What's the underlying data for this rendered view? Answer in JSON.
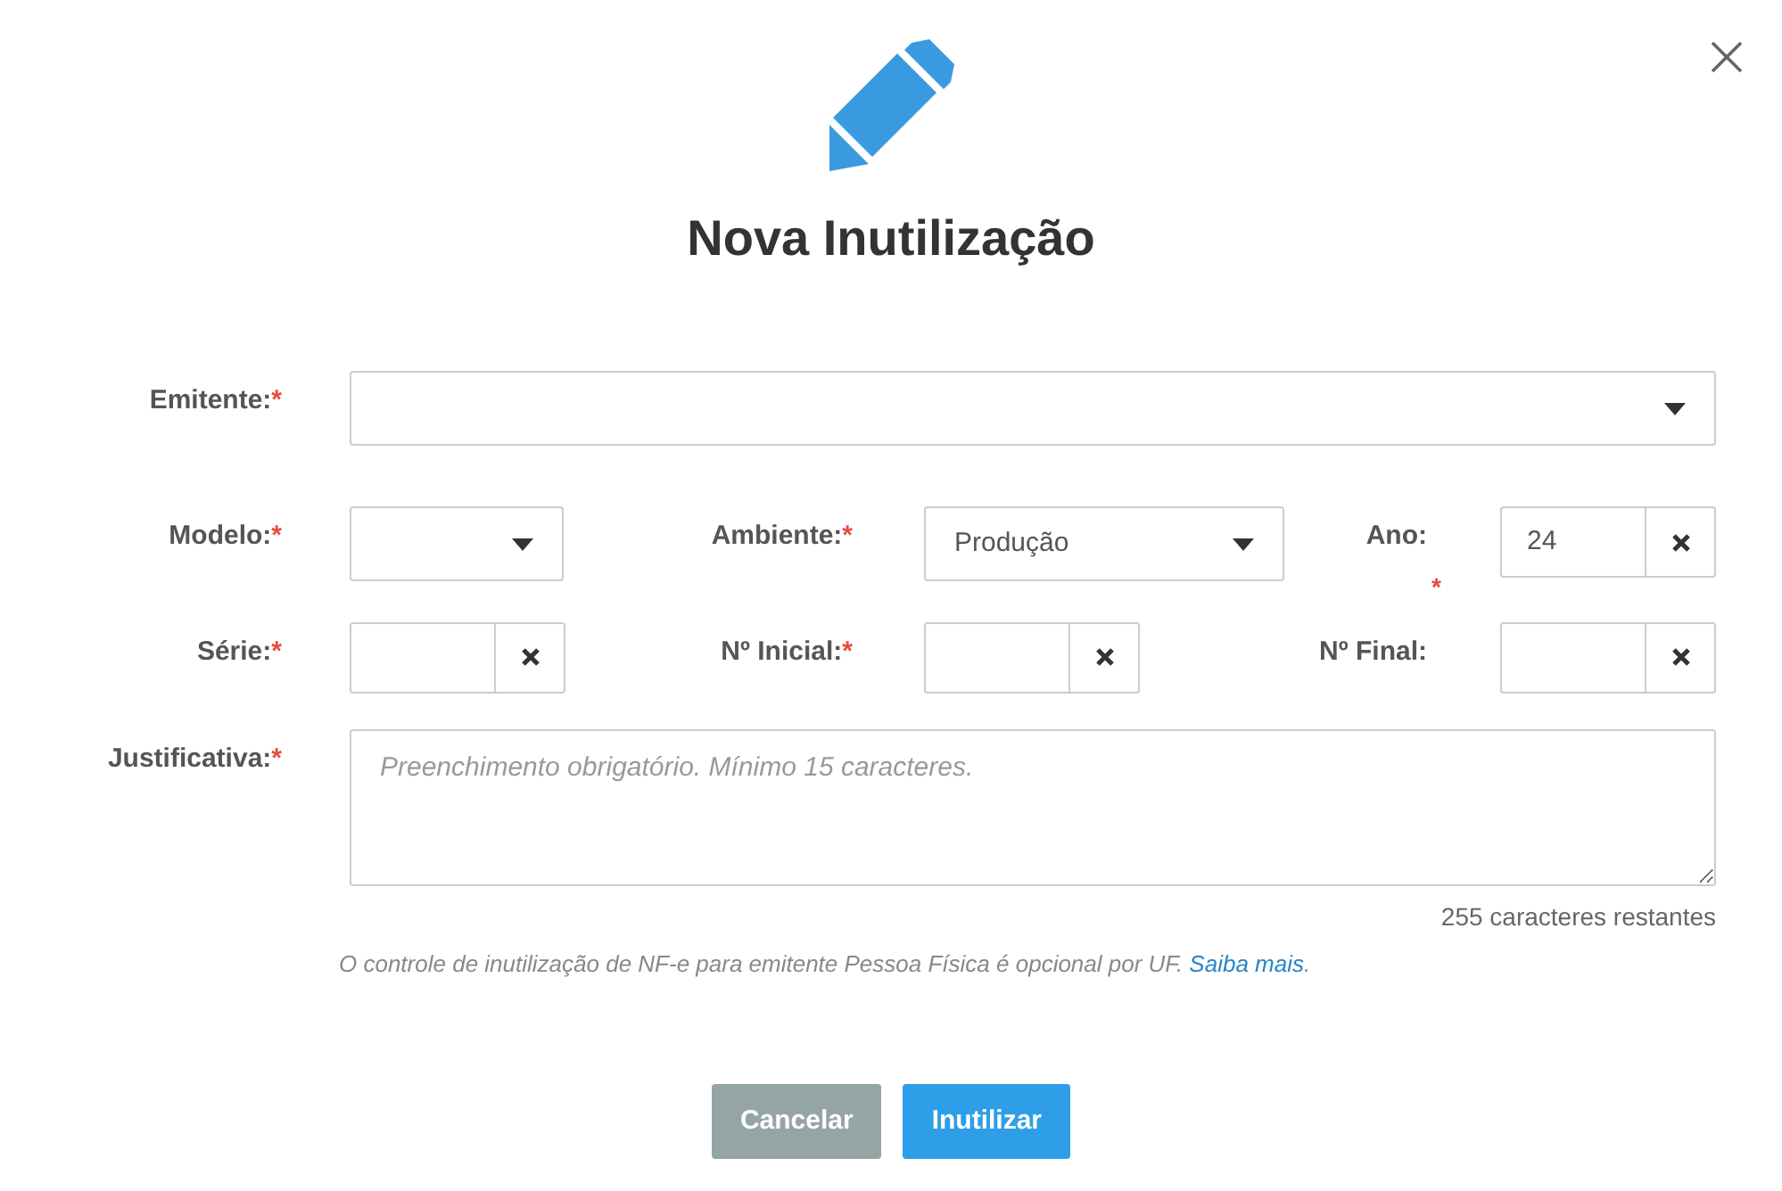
{
  "dialog": {
    "title": "Nova Inutilização"
  },
  "required_mark": "*",
  "rows": [
    [
      {
        "label": "Emitente:",
        "required": true,
        "kind": "select"
      }
    ],
    [
      {
        "label": "Modelo:",
        "required": true,
        "kind": "select"
      },
      {
        "label": "Ambiente:",
        "required": true,
        "kind": "select",
        "value": "Produção"
      },
      {
        "label": "Ano:",
        "required": true,
        "mark_below": true,
        "kind": "clear-input",
        "value": "24"
      }
    ],
    [
      {
        "label": "Série:",
        "required": true,
        "kind": "clear-input"
      },
      {
        "label": "Nº Inicial:",
        "required": true,
        "kind": "clear-input"
      },
      {
        "label": "Nº Final:",
        "required": false,
        "kind": "clear-input"
      }
    ],
    [
      {
        "label": "Justificativa:",
        "required": true,
        "kind": "textarea",
        "placeholder": "Preenchimento obrigatório. Mínimo 15 caracteres."
      }
    ]
  ],
  "counter": "255 caracteres restantes",
  "note": {
    "text": "O controle de inutilização de NF-e para emitente Pessoa Física é opcional por UF.",
    "link": "Saiba mais",
    "end": "."
  },
  "buttons": [
    {
      "label": "Cancelar",
      "kind": "secondary"
    },
    {
      "label": "Inutilizar",
      "kind": "primary"
    }
  ]
}
